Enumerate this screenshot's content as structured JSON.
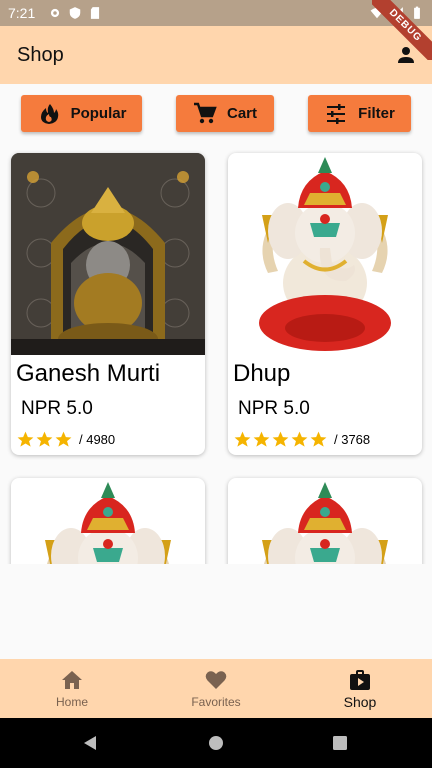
{
  "status_bar": {
    "time": "7:21"
  },
  "app_bar": {
    "title": "Shop",
    "debug_banner": "DEBUG"
  },
  "actions": [
    {
      "label": "Popular",
      "icon": "fire-icon"
    },
    {
      "label": "Cart",
      "icon": "cart-icon"
    },
    {
      "label": "Filter",
      "icon": "tune-icon"
    }
  ],
  "products": [
    {
      "name": "Ganesh Murti",
      "price": "NPR 5.0",
      "stars": 3,
      "rating_count": "/ 4980",
      "image": "temple-idol-photo"
    },
    {
      "name": "Dhup",
      "price": "NPR 5.0",
      "stars": 5,
      "rating_count": "/ 3768",
      "image": "ganesh-illustration"
    },
    {
      "name": "",
      "price": "",
      "stars": 0,
      "rating_count": "",
      "image": "ganesh-illustration"
    },
    {
      "name": "",
      "price": "",
      "stars": 0,
      "rating_count": "",
      "image": "ganesh-illustration"
    }
  ],
  "bottom_nav": [
    {
      "label": "Home",
      "icon": "home-icon",
      "active": false
    },
    {
      "label": "Favorites",
      "icon": "heart-icon",
      "active": false
    },
    {
      "label": "Shop",
      "icon": "shop-bag-icon",
      "active": true
    }
  ],
  "colors": {
    "accent": "#f57b3d",
    "app_bar": "#ffd6ad",
    "star": "#f5b400"
  }
}
